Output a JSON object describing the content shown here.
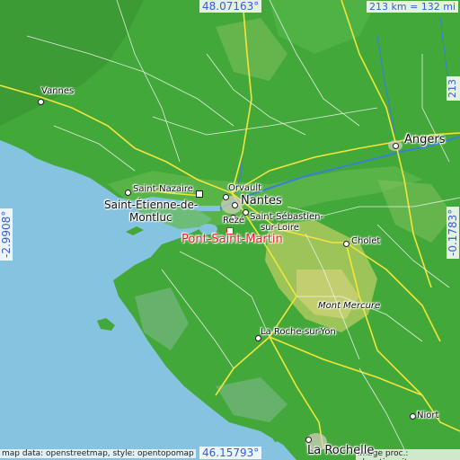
{
  "map": {
    "coordinates": {
      "top": "48.07163°",
      "bottom": "46.15793°",
      "left": "-2.9908°",
      "right": "-0.1783°"
    },
    "scale": "213 km = 132 mi",
    "credits": {
      "left": "map data: openstreetmap, style: opentopomap",
      "right": "image proc.: elevation.city"
    },
    "highlight": "Pont-Saint-Martin",
    "places": {
      "vannes": "Vannes",
      "angers": "Angers",
      "saint_nazaire": "Saint-Nazaire",
      "saint_etienne_line1": "Saint-Étienne-de-",
      "saint_etienne_line2": "Montluc",
      "orvault": "Orvault",
      "nantes": "Nantes",
      "reze": "Rezé",
      "saint_sebastien_line1": "Saint-Sébastien-",
      "saint_sebastien_line2": "sur-Loire",
      "cholet": "Cholet",
      "mont_mercure": "Mont Mercure",
      "la_roche_sur_yon": "La Roche-sur-Yon",
      "niort": "Niort",
      "la_rochelle": "La Rochelle"
    }
  }
}
